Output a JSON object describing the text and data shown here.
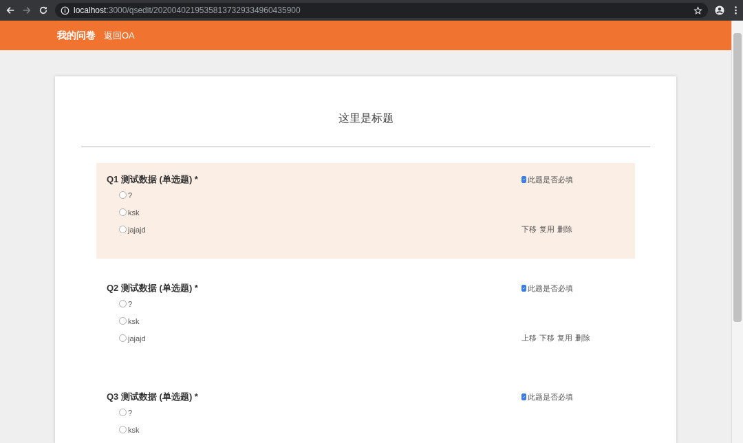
{
  "browser": {
    "url_host": "localhost",
    "url_path": ":3000/qsedit/20200402195358137329334960435900",
    "forward_disabled": true
  },
  "header": {
    "brand": "我的问卷",
    "link": "返回OA"
  },
  "survey": {
    "title": "这里是标题",
    "questions": [
      {
        "title": "Q1 测试数据 (单选题) *",
        "selected": true,
        "required_label": "此题是否必填",
        "required": true,
        "options": [
          {
            "label": "?",
            "selected": false
          },
          {
            "label": "ksk",
            "selected": false
          },
          {
            "label": "jajajd",
            "selected": false
          }
        ],
        "actions": [
          "下移",
          "复用",
          "删除"
        ]
      },
      {
        "title": "Q2 测试数据 (单选题) *",
        "selected": false,
        "required_label": "此题是否必填",
        "required": true,
        "options": [
          {
            "label": "?",
            "selected": false
          },
          {
            "label": "ksk",
            "selected": false
          },
          {
            "label": "jajajd",
            "selected": false
          }
        ],
        "actions": [
          "上移",
          "下移",
          "复用",
          "删除"
        ]
      },
      {
        "title": "Q3 测试数据 (单选题) *",
        "selected": false,
        "required_label": "此题是否必填",
        "required": true,
        "options": [
          {
            "label": "?",
            "selected": false
          },
          {
            "label": "ksk",
            "selected": false
          }
        ]
      }
    ]
  }
}
